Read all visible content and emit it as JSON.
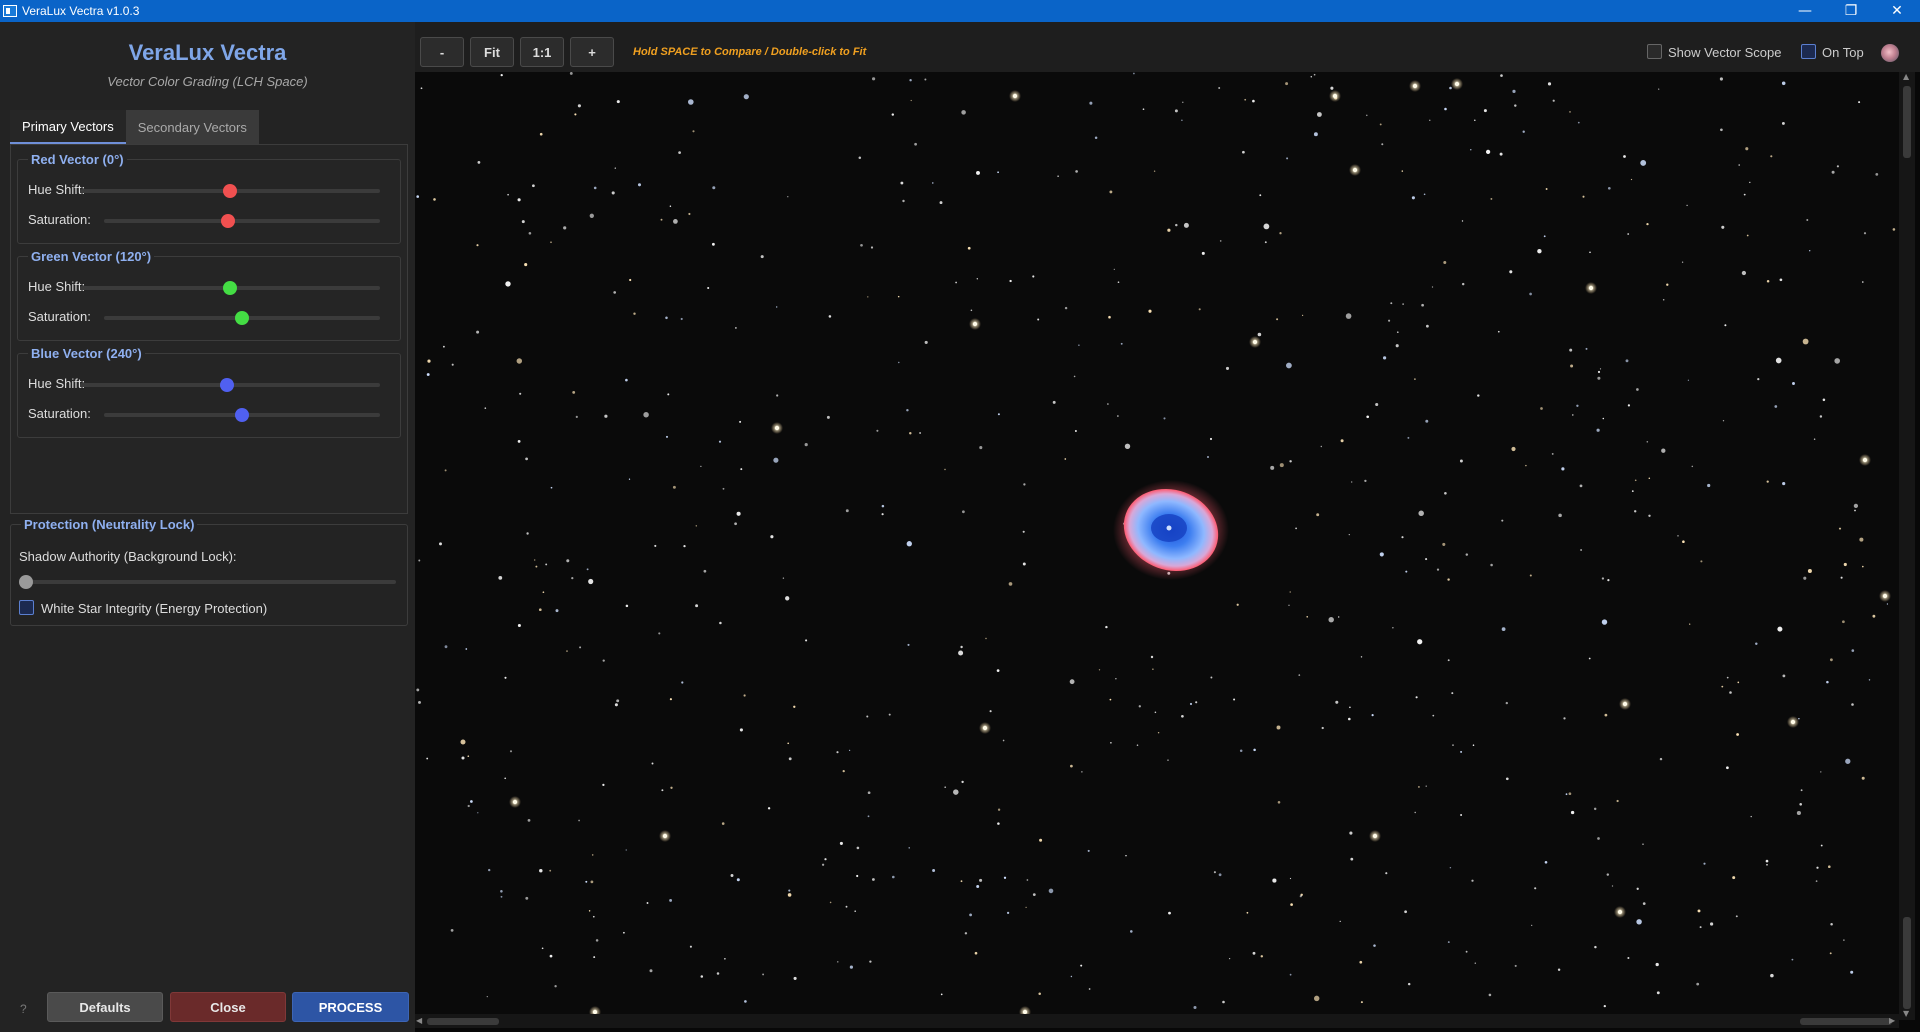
{
  "window": {
    "title": "VeraLux Vectra v1.0.3",
    "minimize": "—",
    "maximize": "❐",
    "close": "✕"
  },
  "sidebar": {
    "app_title": "VeraLux Vectra",
    "app_subtitle": "Vector Color Grading (LCH Space)",
    "tabs": [
      "Primary Vectors",
      "Secondary Vectors"
    ],
    "vectors": [
      {
        "title": "Red Vector (0°)",
        "hue_label": "Hue Shift:",
        "hue_value": 0.5,
        "sat_label": "Saturation:",
        "sat_value": 0.45,
        "color": "#f05050"
      },
      {
        "title": "Green Vector (120°)",
        "hue_label": "Hue Shift:",
        "hue_value": 0.5,
        "sat_label": "Saturation:",
        "sat_value": 0.5,
        "color": "#44dd44"
      },
      {
        "title": "Blue Vector (240°)",
        "hue_label": "Hue Shift:",
        "hue_value": 0.49,
        "sat_label": "Saturation:",
        "sat_value": 0.5,
        "color": "#5060f0"
      }
    ],
    "protection": {
      "title": "Protection (Neutrality Lock)",
      "shadow_label": "Shadow Authority (Background Lock):",
      "shadow_value": 0.0,
      "white_star_label": "White Star Integrity (Energy Protection)",
      "white_star_checked": false
    },
    "help": "?",
    "buttons": {
      "defaults": "Defaults",
      "close": "Close",
      "process": "PROCESS"
    }
  },
  "toolbar": {
    "zoom_out": "-",
    "fit": "Fit",
    "one_to_one": "1:1",
    "zoom_in": "+",
    "hint": "Hold SPACE to Compare / Double-click to Fit",
    "show_scope_label": "Show Vector Scope",
    "show_scope_checked": false,
    "on_top_label": "On Top",
    "on_top_checked": true
  },
  "colors": {
    "accent": "#7fa6e8",
    "titlebar": "#0a64c8",
    "hint": "#f0a020",
    "process": "#2d55a5",
    "close": "#6a2a2a"
  }
}
